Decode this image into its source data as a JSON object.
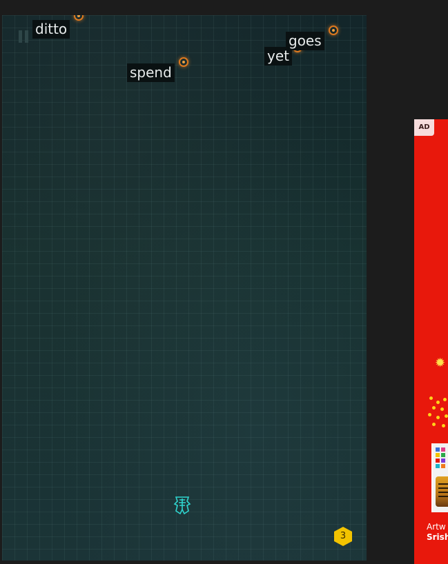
{
  "game": {
    "words": [
      {
        "text": "ditto"
      },
      {
        "text": "spend"
      },
      {
        "text": "yet"
      },
      {
        "text": "goes"
      }
    ],
    "level": "3",
    "colors": {
      "background": "#17302f",
      "mine": "#e07a1e",
      "ship": "#2fd6d0",
      "badge": "#f2c300"
    },
    "icons": {
      "pause": "pause-icon",
      "ship": "spaceship-icon",
      "mine": "target-mine-icon",
      "level": "hexagon-badge-icon"
    }
  },
  "ad": {
    "tag": "AD",
    "credit_line1": "Artw",
    "credit_line2": "Srish",
    "colors": {
      "background": "#e8180c",
      "tag_bg": "#f7dcdc"
    }
  }
}
